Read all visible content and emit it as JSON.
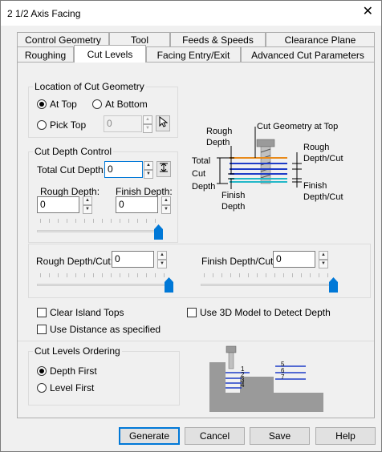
{
  "window": {
    "title": "2 1/2 Axis Facing",
    "close": "✕"
  },
  "tabs_row1": [
    "Control Geometry",
    "Tool",
    "Feeds & Speeds",
    "Clearance Plane"
  ],
  "tabs_row2": [
    "Roughing",
    "Cut Levels",
    "Facing Entry/Exit",
    "Advanced Cut Parameters"
  ],
  "location": {
    "title": "Location of Cut Geometry",
    "at_top": "At Top",
    "at_bottom": "At Bottom",
    "pick_top": "Pick Top",
    "pick_value": "0"
  },
  "cut_depth": {
    "title": "Cut Depth Control",
    "total_label": "Total Cut Depth:",
    "total_value": "0",
    "rough_label": "Rough Depth:",
    "rough_value": "0",
    "finish_label": "Finish Depth:",
    "finish_value": "0"
  },
  "diagram": {
    "rough_depth": "Rough Depth",
    "cut_geometry": "Cut Geometry at Top",
    "total_cut_depth": "Total Cut Depth",
    "finish_depth": "Finish Depth",
    "rough_depth_cut": "Rough Depth/Cut",
    "finish_depth_cut": "Finish Depth/Cut"
  },
  "per_cut": {
    "rough_label": "Rough Depth/Cut:",
    "rough_value": "0",
    "finish_label": "Finish Depth/Cut:",
    "finish_value": "0"
  },
  "options": {
    "clear_island": "Clear Island Tops",
    "use_3d": "Use 3D Model to Detect Depth",
    "use_distance": "Use Distance as specified"
  },
  "ordering": {
    "title": "Cut Levels Ordering",
    "depth_first": "Depth First",
    "level_first": "Level First",
    "left_levels": [
      "1",
      "2",
      "3",
      "4"
    ],
    "right_levels": [
      "5",
      "6",
      "7"
    ]
  },
  "buttons": {
    "generate": "Generate",
    "cancel": "Cancel",
    "save": "Save",
    "help": "Help"
  },
  "colors": {
    "accent": "#0078d7",
    "diagram_blue": "#1e3cc8",
    "diagram_cyan": "#22b8c8",
    "diagram_orange": "#e88a1a"
  }
}
